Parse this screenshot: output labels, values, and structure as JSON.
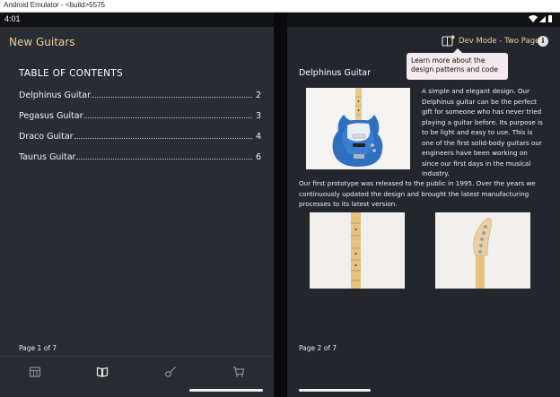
{
  "window": {
    "title": "Android Emulator - <build>5575"
  },
  "status": {
    "time": "4:01"
  },
  "left": {
    "app_title": "New Guitars",
    "toc_heading": "TABLE OF CONTENTS",
    "toc": [
      {
        "label": "Delphinus Guitar",
        "page": "2"
      },
      {
        "label": "Pegasus Guitar",
        "page": "3"
      },
      {
        "label": "Draco Guitar",
        "page": "4"
      },
      {
        "label": "Taurus Guitar",
        "page": "6"
      }
    ],
    "page_label": "Page 1 of 7",
    "nav": [
      "gallery-icon",
      "book-icon",
      "guitar-icon",
      "cart-icon"
    ]
  },
  "right": {
    "dev_mode": "Dev Mode - Two Page",
    "info": "i",
    "tooltip": "Learn more about the design patterns and code",
    "article_title": "Delphinus Guitar",
    "paragraph1": "A simple and elegant design. Our Delphinus guitar can be the perfect gift for someone who has never tried playing a guitar before. Its purpose is to be light and easy to use. This is one of the first solid-body guitars our engineers have been working on since our first days in the musical industry.",
    "paragraph2": "Our first prototype was released to the public in 1995. Over the years we continuously updated the design and brought the latest manufacturing processes to its latest version.",
    "page_label": "Page 2 of 7"
  },
  "colors": {
    "accent": "#e8cfa0",
    "guitar_blue": "#2f6fc0",
    "maple": "#e8c98a"
  }
}
